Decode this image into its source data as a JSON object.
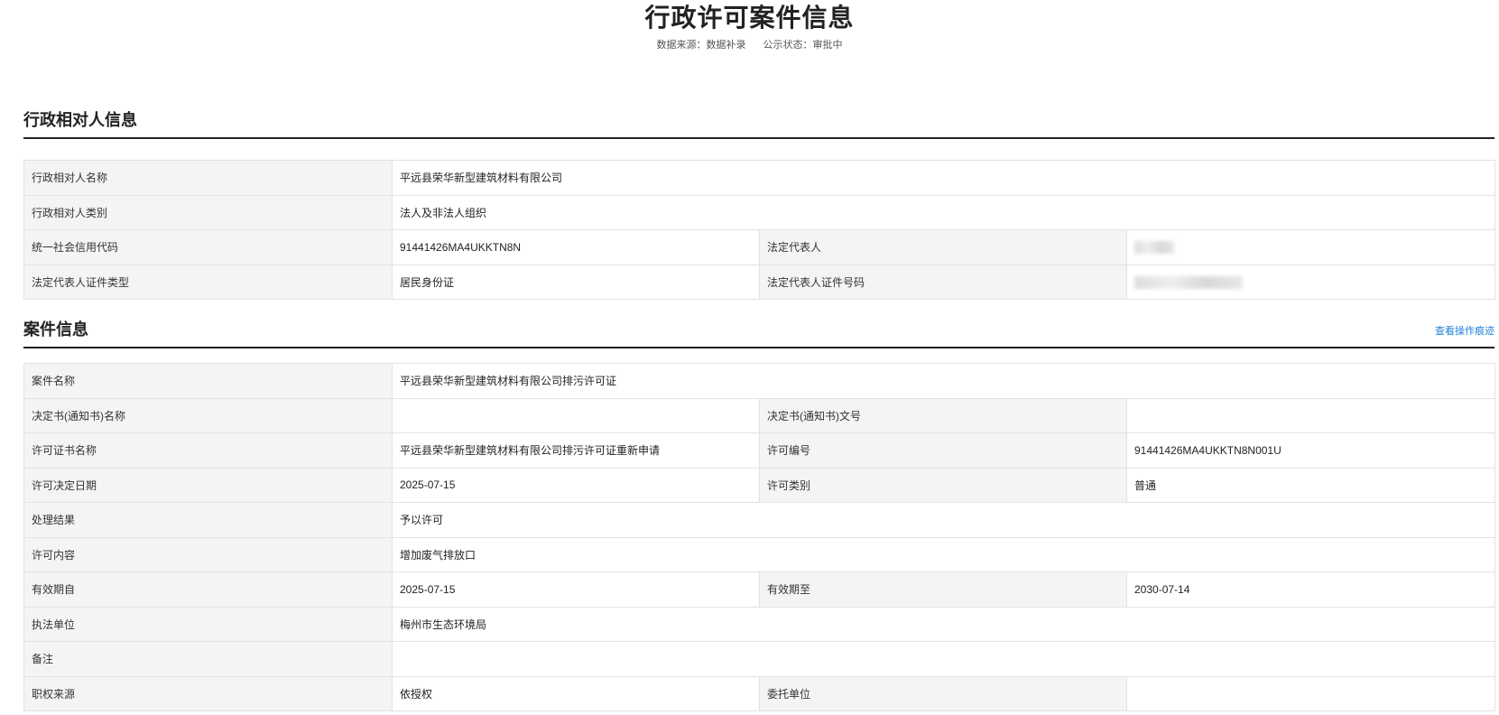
{
  "header": {
    "title": "行政许可案件信息",
    "source": "数据来源：数据补录",
    "status": "公示状态：审批中"
  },
  "party": {
    "section_title": "行政相对人信息",
    "name_label": "行政相对人名称",
    "name_value": "平远县荣华新型建筑材料有限公司",
    "category_label": "行政相对人类别",
    "category_value": "法人及非法人组织",
    "credit_code_label": "统一社会信用代码",
    "credit_code_value": "91441426MA4UKKTN8N",
    "legal_rep_label": "法定代表人",
    "id_type_label": "法定代表人证件类型",
    "id_type_value": "居民身份证",
    "id_number_label": "法定代表人证件号码"
  },
  "case": {
    "section_title": "案件信息",
    "ops_link": "查看操作痕迹",
    "case_name_label": "案件名称",
    "case_name_value": "平远县荣华新型建筑材料有限公司排污许可证",
    "decision_name_label": "决定书(通知书)名称",
    "decision_name_value": "",
    "decision_no_label": "决定书(通知书)文号",
    "decision_no_value": "",
    "cert_name_label": "许可证书名称",
    "cert_name_value": "平远县荣华新型建筑材料有限公司排污许可证重新申请",
    "permit_no_label": "许可编号",
    "permit_no_value": "91441426MA4UKKTN8N001U",
    "decision_date_label": "许可决定日期",
    "decision_date_value": "2025-07-15",
    "permit_type_label": "许可类别",
    "permit_type_value": "普通",
    "result_label": "处理结果",
    "result_value": "予以许可",
    "content_label": "许可内容",
    "content_value": "增加废气排放口",
    "valid_from_label": "有效期自",
    "valid_from_value": "2025-07-15",
    "valid_to_label": "有效期至",
    "valid_to_value": "2030-07-14",
    "agency_label": "执法单位",
    "agency_value": "梅州市生态环境局",
    "remark_label": "备注",
    "remark_value": "",
    "authority_label": "职权来源",
    "authority_value": "依授权",
    "entrusted_label": "委托单位",
    "entrusted_value": ""
  }
}
